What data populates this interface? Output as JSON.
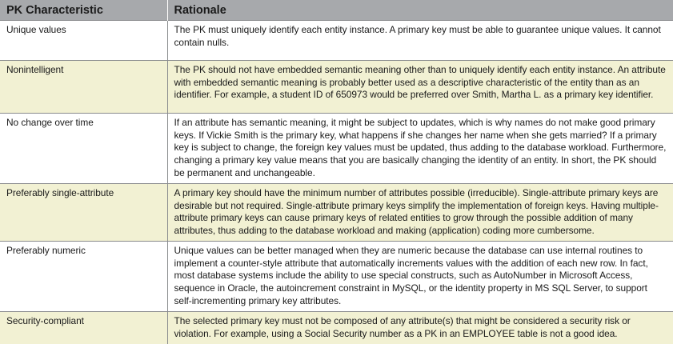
{
  "header": {
    "col1": "PK Characteristic",
    "col2": "Rationale"
  },
  "rows": [
    {
      "characteristic": "Unique values",
      "rationale": "The PK must uniquely identify each entity instance. A primary key must be able to guarantee unique values. It cannot contain nulls."
    },
    {
      "characteristic": "Nonintelligent",
      "rationale": "The PK should not have embedded semantic meaning other than to uniquely identify each entity instance. An attribute with embedded semantic meaning is probably better used as a descriptive characteristic of the entity than as an identifier. For example, a student ID of 650973 would be preferred over Smith, Martha L. as a primary key identifier."
    },
    {
      "characteristic": "No change over time",
      "rationale": "If an attribute has semantic meaning, it might be subject to updates, which is why names do not make good primary keys. If Vickie Smith is the primary key, what happens if she changes her name when she gets married? If a primary key is subject to change, the foreign key values must be updated, thus adding to the database workload. Furthermore, changing a primary key value means that you are basically changing the identity of an entity. In short, the PK should be permanent and unchangeable."
    },
    {
      "characteristic": "Preferably single-attribute",
      "rationale": "A primary key should have the minimum number of attributes possible (irreducible). Single-attribute primary keys are desirable but not required. Single-attribute primary keys simplify the implementation of foreign keys. Having multiple-attribute primary keys can cause primary keys of related entities to grow through the possible addition of many attributes, thus adding to the database workload and making (application) coding more cumbersome."
    },
    {
      "characteristic": "Preferably numeric",
      "rationale": "Unique values can be better managed when they are numeric because the database can use internal routines to implement a counter-style attribute that automatically increments values with the addition of each new row. In fact, most database systems include the ability to use special constructs, such as AutoNumber in Microsoft Access, sequence in Oracle, the autoincrement constraint in MySQL, or the identity property in MS SQL Server, to support self-incrementing primary key attributes."
    },
    {
      "characteristic": "Security-compliant",
      "rationale": "The selected primary key must not be composed of any attribute(s) that might be considered a security risk or violation. For example, using a Social Security number as a PK in an EMPLOYEE table is not a good idea."
    }
  ]
}
